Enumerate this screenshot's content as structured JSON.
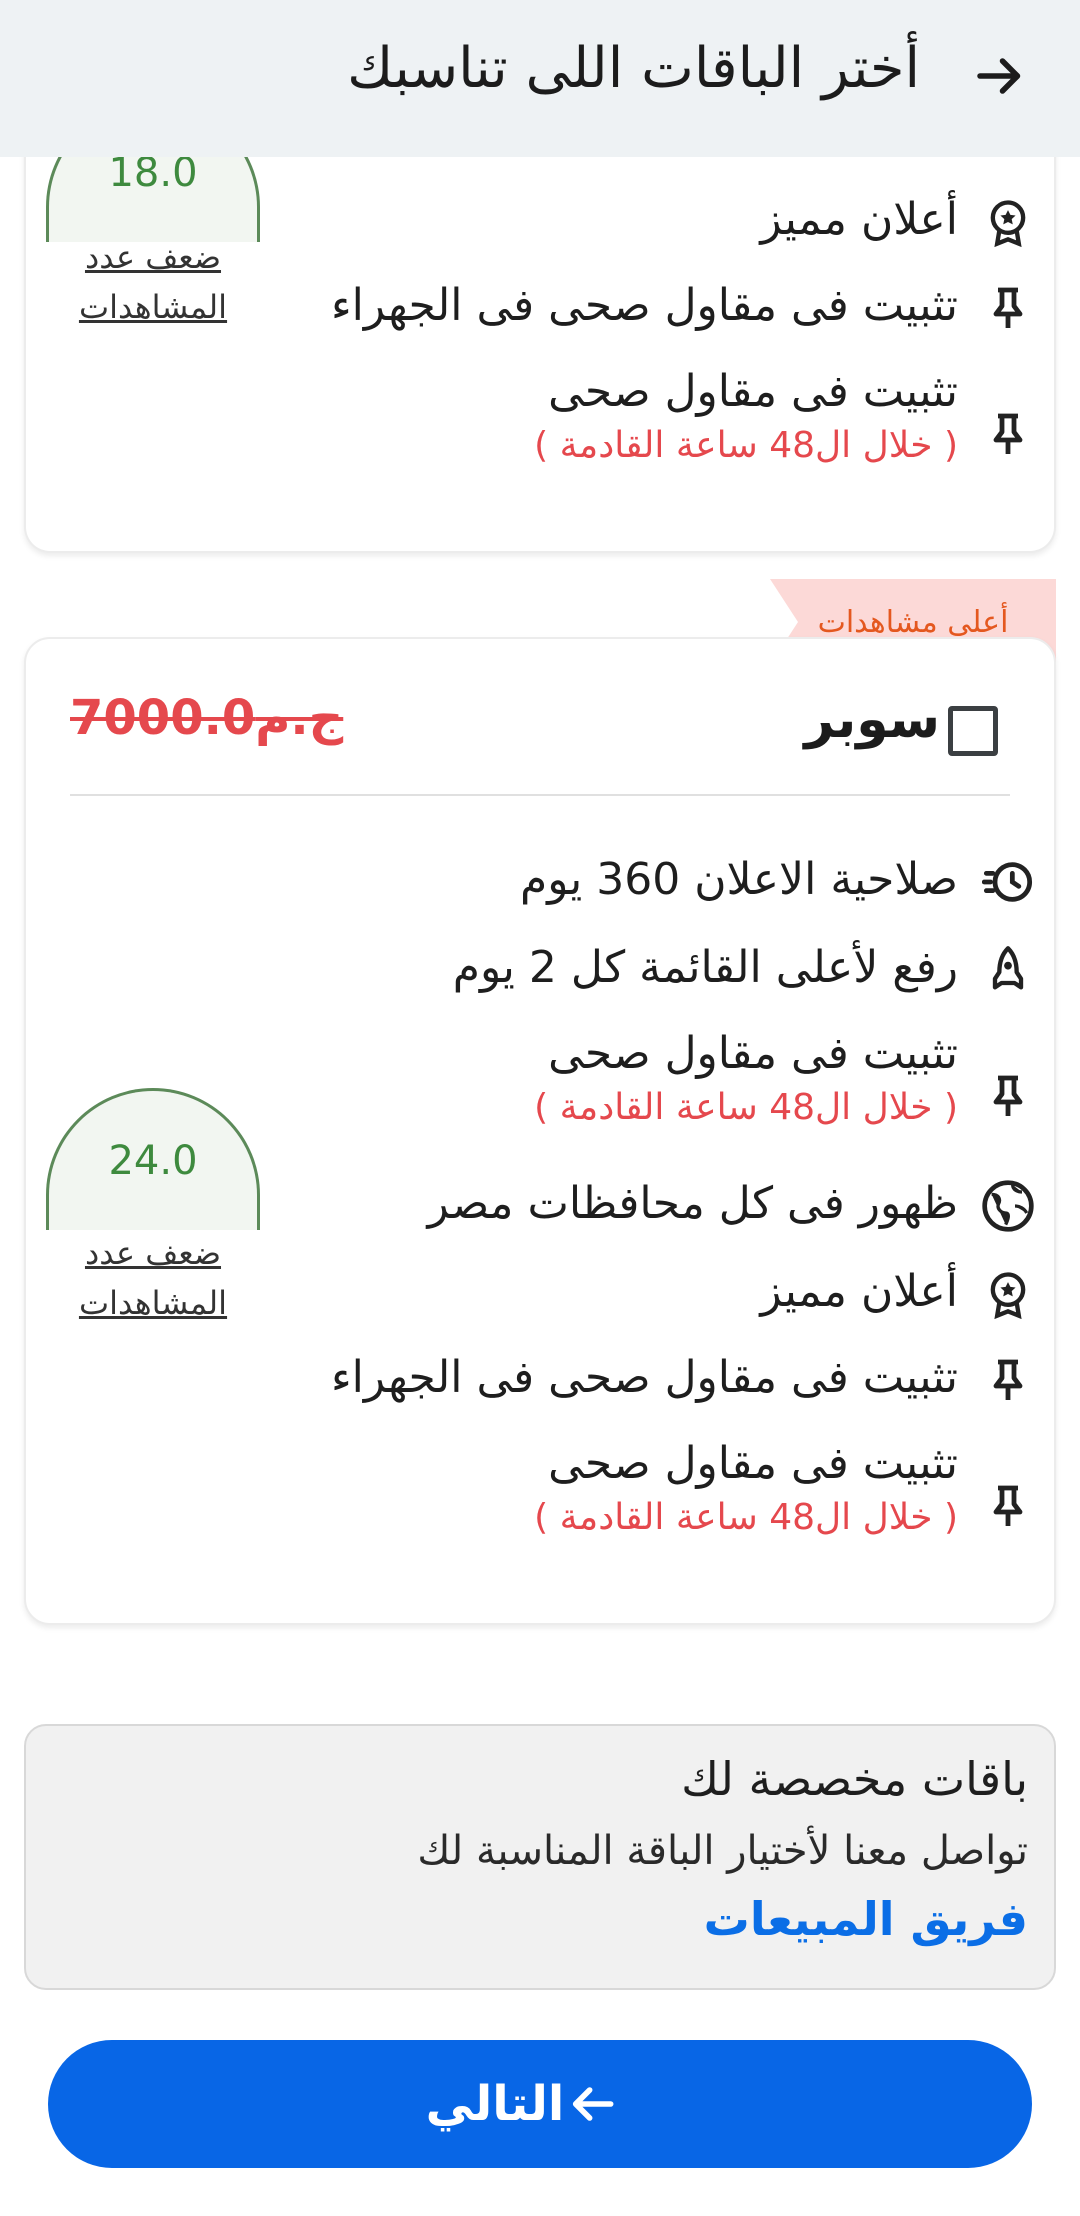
{
  "header": {
    "title": "أختر الباقات اللى تناسبك",
    "back_icon": "arrow-right-icon"
  },
  "card_top": {
    "arch_value": "18.0",
    "arch_label": "ضعف عدد المشاهدات",
    "features": [
      {
        "icon": "award-icon",
        "text": "أعلان مميز"
      },
      {
        "icon": "pin-icon",
        "text": "تثبيت فى مقاول صحى فى الجهراء"
      },
      {
        "icon": "pin-icon",
        "text": "تثبيت فى مقاول صحى",
        "sub": "( خلال ال48 ساعة القادمة )"
      }
    ]
  },
  "card_super": {
    "ribbon": "أعلى مشاهدات",
    "name": "سوبر",
    "price": "7000.0ج.م",
    "checked": false,
    "arch_value": "24.0",
    "arch_label": "ضعف عدد المشاهدات",
    "features": [
      {
        "icon": "timer-icon",
        "text": "صلاحية الاعلان 360 يوم"
      },
      {
        "icon": "rocket-icon",
        "text": "رفع لأعلى القائمة كل 2 يوم"
      },
      {
        "icon": "pin-icon",
        "text": "تثبيت فى مقاول صحى",
        "sub": "( خلال ال48 ساعة القادمة )"
      },
      {
        "icon": "globe-icon",
        "text": "ظهور فى كل محافظات مصر"
      },
      {
        "icon": "award-icon",
        "text": "أعلان مميز"
      },
      {
        "icon": "pin-icon",
        "text": "تثبيت فى مقاول صحى فى الجهراء"
      },
      {
        "icon": "pin-icon",
        "text": "تثبيت فى مقاول صحى",
        "sub": "( خلال ال48 ساعة القادمة )"
      }
    ]
  },
  "custom": {
    "title": "باقات مخصصة لك",
    "description": "تواصل معنا لأختيار الباقة المناسبة لك",
    "link": "فريق المبيعات"
  },
  "next_button": {
    "label": "التالي",
    "icon": "arrow-left-icon"
  },
  "colors": {
    "primary": "#0866e6",
    "price_red": "#e5484d",
    "ribbon_bg": "#fcd9d7",
    "ribbon_text": "#e4581f",
    "arch_green": "#5c8a59"
  }
}
